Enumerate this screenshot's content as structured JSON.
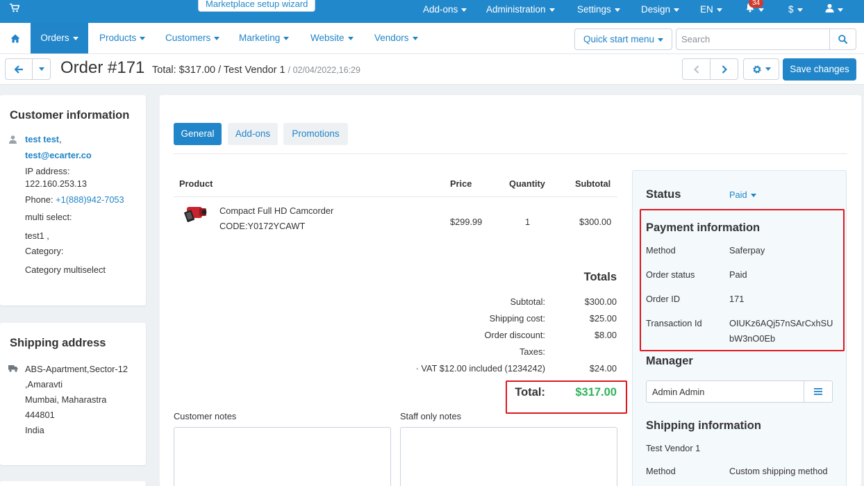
{
  "topbar": {
    "wizard": "Marketplace setup wizard",
    "menus": [
      "Add-ons",
      "Administration",
      "Settings",
      "Design",
      "EN"
    ],
    "notification_count": "34",
    "currency": "$"
  },
  "navbar": {
    "items": [
      "Orders",
      "Products",
      "Customers",
      "Marketing",
      "Website",
      "Vendors"
    ],
    "quick_start": "Quick start menu",
    "search_placeholder": "Search"
  },
  "titlebar": {
    "title": "Order #171",
    "total_vendor": "Total: $317.00 / Test Vendor 1",
    "date": "/ 02/04/2022,16:29",
    "save": "Save changes"
  },
  "customer": {
    "heading": "Customer information",
    "name": "test test",
    "email": "test@ecarter.co",
    "ip_label": "IP address:",
    "ip": "122.160.253.13",
    "phone_label": "Phone:",
    "phone": "+1(888)942-7053",
    "multi_select": "multi select:",
    "multi_select_value": "test1 ,",
    "category": "Category:",
    "category_value": "Category multiselect"
  },
  "shipping_address": {
    "heading": "Shipping address",
    "lines": [
      "ABS-Apartment,Sector-12",
      ",Amaravti",
      "Mumbai, Maharastra",
      "444801",
      "India"
    ]
  },
  "tabs": [
    "General",
    "Add-ons",
    "Promotions"
  ],
  "products": {
    "headers": [
      "Product",
      "Price",
      "Quantity",
      "Subtotal"
    ],
    "rows": [
      {
        "name": "Compact Full HD Camcorder",
        "code": "CODE:Y0172YCAWT",
        "price": "$299.99",
        "qty": "1",
        "subtotal": "$300.00"
      }
    ]
  },
  "totals": {
    "heading": "Totals",
    "rows": [
      {
        "label": "Subtotal:",
        "value": "$300.00"
      },
      {
        "label": "Shipping cost:",
        "value": "$25.00"
      },
      {
        "label": "Order discount:",
        "value": "$8.00"
      },
      {
        "label": "Taxes:",
        "value": ""
      },
      {
        "label": "· VAT  $12.00  included (1234242)",
        "value": "$24.00"
      }
    ],
    "total_label": "Total:",
    "total_value": "$317.00"
  },
  "notes": {
    "customer": "Customer notes",
    "staff": "Staff only notes"
  },
  "sidebar": {
    "status_label": "Status",
    "status_value": "Paid",
    "payment_heading": "Payment information",
    "payment": [
      {
        "label": "Method",
        "value": "Saferpay"
      },
      {
        "label": "Order status",
        "value": "Paid"
      },
      {
        "label": "Order ID",
        "value": "171"
      },
      {
        "label": "Transaction Id",
        "value": "OIUKz6AQj57nSArCxhSU",
        "value2": "bW3nO0Eb"
      }
    ],
    "manager_heading": "Manager",
    "manager_value": "Admin Admin",
    "shipping_heading": "Shipping information",
    "shipping_vendor": "Test Vendor 1",
    "shipping_method_label": "Method",
    "shipping_method_value": "Custom shipping method"
  },
  "colors": {
    "primary": "#2185c9",
    "total_green": "#2fb35a",
    "highlight_red": "#e0151e"
  }
}
